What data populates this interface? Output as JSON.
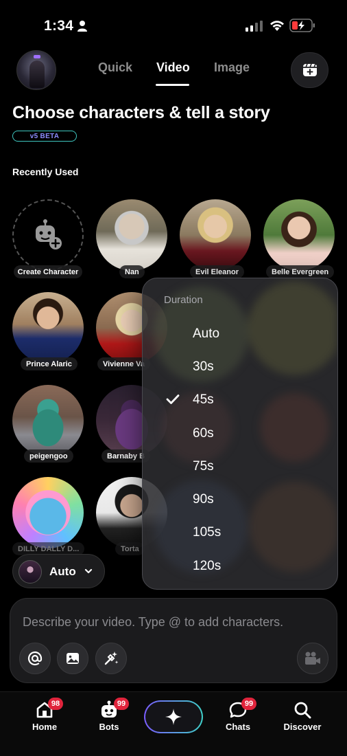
{
  "status_bar": {
    "time": "1:34"
  },
  "header": {
    "tabs": [
      {
        "label": "Quick",
        "active": false
      },
      {
        "label": "Video",
        "active": true
      },
      {
        "label": "Image",
        "active": false
      }
    ]
  },
  "page": {
    "title": "Choose characters & tell a story",
    "badge": "v5 BETA",
    "section_label": "Recently Used"
  },
  "characters": [
    {
      "name": "Create Character"
    },
    {
      "name": "Nan"
    },
    {
      "name": "Evil Eleanor"
    },
    {
      "name": "Belle Evergreen"
    },
    {
      "name": "Prince Alaric"
    },
    {
      "name": "Vivienne Va"
    },
    {
      "name": "peigengoo"
    },
    {
      "name": "Barnaby B"
    },
    {
      "name": "DILLY DALLY D..."
    },
    {
      "name": "Torta"
    }
  ],
  "duration_menu": {
    "title": "Duration",
    "options": [
      "Auto",
      "30s",
      "45s",
      "60s",
      "75s",
      "90s",
      "105s",
      "120s"
    ],
    "selected": "45s"
  },
  "model_selector": {
    "value": "Auto"
  },
  "prompt": {
    "placeholder": "Describe your video. Type @ to add characters."
  },
  "bottom_nav": {
    "items": [
      {
        "label": "Home",
        "badge": "98"
      },
      {
        "label": "Bots",
        "badge": "99"
      },
      {
        "label": "Chats",
        "badge": "99"
      },
      {
        "label": "Discover",
        "badge": ""
      }
    ]
  },
  "colors": {
    "background": "#000000",
    "accent_gradient_start": "#7a5cff",
    "accent_gradient_end": "#3fd0c8",
    "badge_red": "#e0243c"
  }
}
